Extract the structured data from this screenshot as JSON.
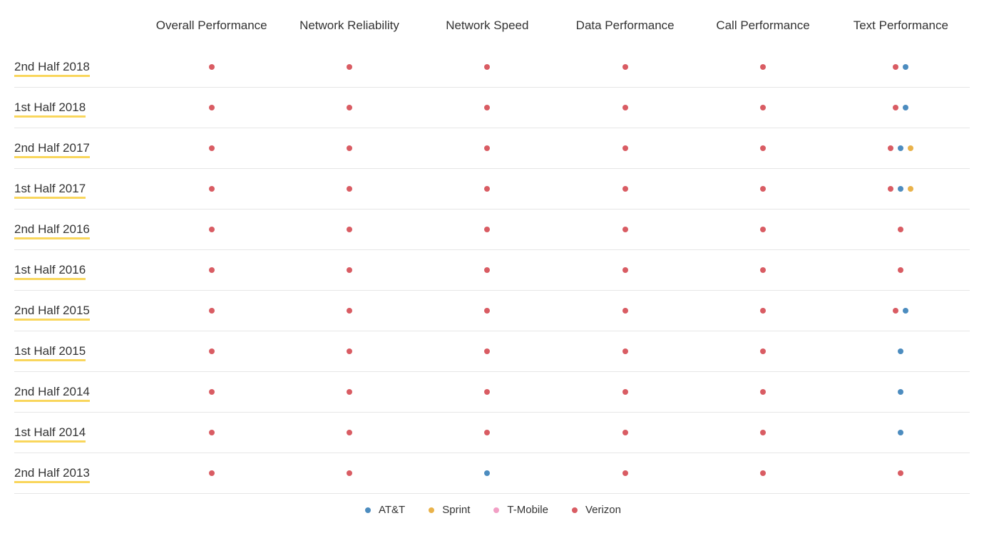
{
  "chart_data": {
    "type": "table",
    "title": "",
    "carriers": {
      "att": {
        "name": "AT&T",
        "color": "#4C8CBF"
      },
      "sprint": {
        "name": "Sprint",
        "color": "#E9B24A"
      },
      "tmobile": {
        "name": "T-Mobile",
        "color": "#F29FC5"
      },
      "verizon": {
        "name": "Verizon",
        "color": "#D95C63"
      }
    },
    "columns": [
      "Overall Performance",
      "Network Reliability",
      "Network Speed",
      "Data Performance",
      "Call Performance",
      "Text Performance"
    ],
    "periods": [
      {
        "label": "2nd Half 2018",
        "winners": [
          [
            "verizon"
          ],
          [
            "verizon"
          ],
          [
            "verizon"
          ],
          [
            "verizon"
          ],
          [
            "verizon"
          ],
          [
            "verizon",
            "att"
          ]
        ]
      },
      {
        "label": "1st Half 2018",
        "winners": [
          [
            "verizon"
          ],
          [
            "verizon"
          ],
          [
            "verizon"
          ],
          [
            "verizon"
          ],
          [
            "verizon"
          ],
          [
            "verizon",
            "att"
          ]
        ]
      },
      {
        "label": "2nd Half 2017",
        "winners": [
          [
            "verizon"
          ],
          [
            "verizon"
          ],
          [
            "verizon"
          ],
          [
            "verizon"
          ],
          [
            "verizon"
          ],
          [
            "verizon",
            "att",
            "sprint"
          ]
        ]
      },
      {
        "label": "1st Half 2017",
        "winners": [
          [
            "verizon"
          ],
          [
            "verizon"
          ],
          [
            "verizon"
          ],
          [
            "verizon"
          ],
          [
            "verizon"
          ],
          [
            "verizon",
            "att",
            "sprint"
          ]
        ]
      },
      {
        "label": "2nd Half 2016",
        "winners": [
          [
            "verizon"
          ],
          [
            "verizon"
          ],
          [
            "verizon"
          ],
          [
            "verizon"
          ],
          [
            "verizon"
          ],
          [
            "verizon"
          ]
        ]
      },
      {
        "label": "1st Half 2016",
        "winners": [
          [
            "verizon"
          ],
          [
            "verizon"
          ],
          [
            "verizon"
          ],
          [
            "verizon"
          ],
          [
            "verizon"
          ],
          [
            "verizon"
          ]
        ]
      },
      {
        "label": "2nd Half 2015",
        "winners": [
          [
            "verizon"
          ],
          [
            "verizon"
          ],
          [
            "verizon"
          ],
          [
            "verizon"
          ],
          [
            "verizon"
          ],
          [
            "verizon",
            "att"
          ]
        ]
      },
      {
        "label": "1st Half 2015",
        "winners": [
          [
            "verizon"
          ],
          [
            "verizon"
          ],
          [
            "verizon"
          ],
          [
            "verizon"
          ],
          [
            "verizon"
          ],
          [
            "att"
          ]
        ]
      },
      {
        "label": "2nd Half 2014",
        "winners": [
          [
            "verizon"
          ],
          [
            "verizon"
          ],
          [
            "verizon"
          ],
          [
            "verizon"
          ],
          [
            "verizon"
          ],
          [
            "att"
          ]
        ]
      },
      {
        "label": "1st Half 2014",
        "winners": [
          [
            "verizon"
          ],
          [
            "verizon"
          ],
          [
            "verizon"
          ],
          [
            "verizon"
          ],
          [
            "verizon"
          ],
          [
            "att"
          ]
        ]
      },
      {
        "label": "2nd Half 2013",
        "winners": [
          [
            "verizon"
          ],
          [
            "verizon"
          ],
          [
            "att"
          ],
          [
            "verizon"
          ],
          [
            "verizon"
          ],
          [
            "verizon"
          ]
        ]
      }
    ],
    "legend_order": [
      "att",
      "sprint",
      "tmobile",
      "verizon"
    ]
  }
}
